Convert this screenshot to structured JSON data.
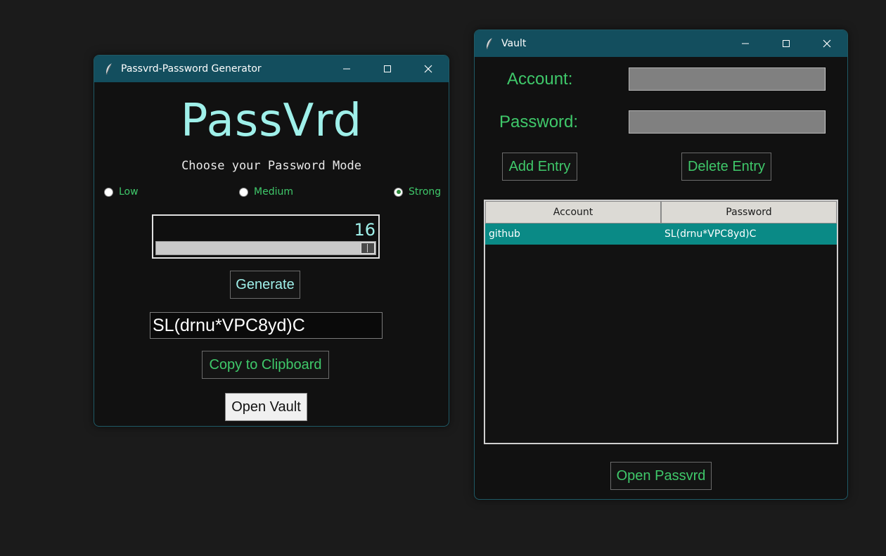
{
  "generator": {
    "window_title": "Passvrd-Password Generator",
    "logo": "PassVrd",
    "mode_heading": "Choose your Password Mode",
    "modes": [
      {
        "label": "Low",
        "selected": false
      },
      {
        "label": "Medium",
        "selected": false
      },
      {
        "label": "Strong",
        "selected": true
      }
    ],
    "length_value": "16",
    "length_fraction": 1.0,
    "generate_label": "Generate",
    "password_value": "SL(drnu*VPC8yd)C",
    "copy_label": "Copy to Clipboard",
    "open_vault_label": "Open Vault"
  },
  "vault": {
    "window_title": "Vault",
    "account_label": "Account:",
    "password_label": "Password:",
    "account_value": "",
    "password_value": "",
    "add_label": "Add Entry",
    "delete_label": "Delete Entry",
    "columns": [
      "Account",
      "Password"
    ],
    "rows": [
      {
        "account": "github",
        "password": "SL(drnu*VPC8yd)C",
        "selected": true
      }
    ],
    "open_passvrd_label": "Open Passvrd"
  },
  "colors": {
    "background": "#1b1b1b",
    "titlebar": "#134e5e",
    "window_bg": "#111111",
    "accent_teal": "#9ff0ea",
    "accent_green": "#3fc86a",
    "selected_row": "#0a8a86"
  },
  "icons": {
    "app": "feather-icon",
    "minimize": "minimize-icon",
    "maximize": "maximize-icon",
    "close": "close-icon"
  }
}
